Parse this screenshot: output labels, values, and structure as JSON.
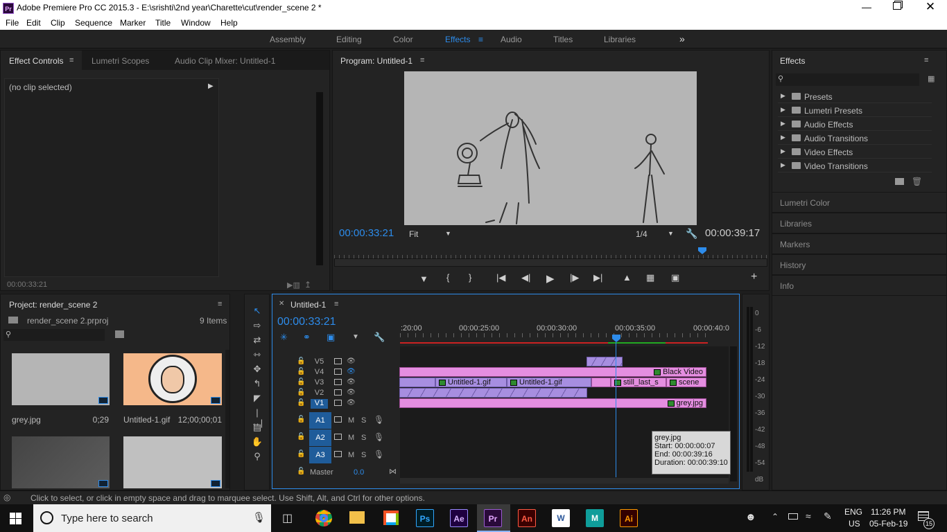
{
  "title": {
    "text": "Adobe Premiere Pro CC 2015.3 - E:\\srishti\\2nd year\\Charette\\cut\\render_scene 2 *",
    "app_icon": "Pr"
  },
  "menu": [
    "File",
    "Edit",
    "Clip",
    "Sequence",
    "Marker",
    "Title",
    "Window",
    "Help"
  ],
  "workspaces": [
    "Assembly",
    "Editing",
    "Color",
    "Effects",
    "Audio",
    "Titles",
    "Libraries",
    "»"
  ],
  "active_workspace": "Effects",
  "source_panel": {
    "tabs": [
      "Effect Controls",
      "Lumetri Scopes",
      "Audio Clip Mixer: Untitled-1"
    ],
    "no_clip": "(no clip selected)",
    "timecode": "00:00:33:21"
  },
  "program": {
    "title": "Program: Untitled-1",
    "timecode_left": "00:00:33:21",
    "fit": "Fit",
    "resolution": "1/4",
    "timecode_right": "00:00:39:17",
    "playhead_fraction": 0.84
  },
  "effects_panel": {
    "title": "Effects",
    "items": [
      "Presets",
      "Lumetri Presets",
      "Audio Effects",
      "Audio Transitions",
      "Video Effects",
      "Video Transitions"
    ],
    "side_panels": [
      "Lumetri Color",
      "Libraries",
      "Markers",
      "History",
      "Info"
    ]
  },
  "project": {
    "title": "Project: render_scene 2",
    "file": "render_scene 2.prproj",
    "count": "9 Items",
    "items": [
      {
        "name": "grey.jpg",
        "duration": "0;29"
      },
      {
        "name": "Untitled-1.gif",
        "duration": "12;00;00;01"
      }
    ]
  },
  "timeline": {
    "title": "Untitled-1",
    "timecode": "00:00:33:21",
    "ruler": [
      ":20:00",
      "00:00:25:00",
      "00:00:30:00",
      "00:00:35:00",
      "00:00:40:0"
    ],
    "video_tracks": [
      "V5",
      "V4",
      "V3",
      "V2",
      "V1"
    ],
    "audio_tracks": [
      "A1",
      "A2",
      "A3"
    ],
    "master_label": "Master",
    "master_value": "0.0",
    "mute": "M",
    "solo": "S",
    "clips": {
      "v4": "Black Video",
      "v3a": "Untitled-1.gif",
      "v3b": "Untitled-1.gif",
      "v3c": "still_last_s",
      "v3d": "scene",
      "v1": "grey.jpg"
    },
    "tooltip": {
      "name": "grey.jpg",
      "start": "Start: 00:00:00:07",
      "end": "End: 00:00:39:16",
      "duration": "Duration: 00:00:39:10"
    }
  },
  "meter_labels": [
    "0",
    "-6",
    "-12",
    "-18",
    "-24",
    "-30",
    "-36",
    "-42",
    "-48",
    "-54",
    "dB"
  ],
  "meter_bottom": "dB",
  "status": "Click to select, or click in empty space and drag to marquee select. Use Shift, Alt, and Ctrl for other options.",
  "taskbar": {
    "search_placeholder": "Type here to search",
    "lang": "ENG",
    "region": "US",
    "time": "11:26 PM",
    "date": "05-Feb-19",
    "notifications": "15",
    "apps": [
      "Ps",
      "Ae",
      "Pr",
      "An",
      "W",
      "M",
      "Ai"
    ]
  },
  "colors": {
    "accent": "#2d8ceb",
    "clip_pink": "#e48ee0",
    "clip_purple": "#a78ee0",
    "timeline_red": "#cc2222"
  }
}
